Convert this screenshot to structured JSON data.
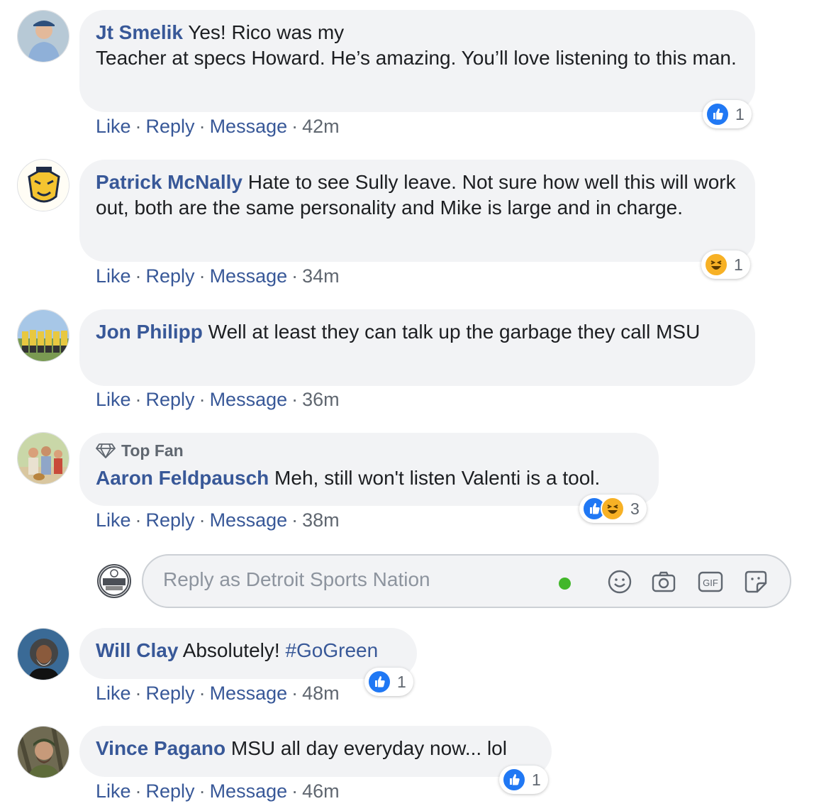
{
  "comments": [
    {
      "author": "Jt Smelik",
      "text": "Yes! Rico was my\nTeacher at specs Howard. He’s amazing. You’ll love listening to this man.",
      "actions": {
        "like": "Like",
        "reply": "Reply",
        "message": "Message",
        "time": "42m"
      },
      "reactions": {
        "icons": [
          "like-icon"
        ],
        "count": "1"
      }
    },
    {
      "author": "Patrick McNally",
      "text": "Hate to see Sully leave. Not sure how well this will work out, both are the same personality and Mike is large and in charge.",
      "actions": {
        "like": "Like",
        "reply": "Reply",
        "message": "Message",
        "time": "34m"
      },
      "reactions": {
        "icons": [
          "haha-icon"
        ],
        "count": "1"
      }
    },
    {
      "author": "Jon Philipp",
      "text": "Well at least they can talk up the garbage they call MSU",
      "actions": {
        "like": "Like",
        "reply": "Reply",
        "message": "Message",
        "time": "36m"
      }
    },
    {
      "badge": "Top Fan",
      "author": "Aaron Feldpausch",
      "text": "Meh, still won't listen Valenti is a tool.",
      "actions": {
        "like": "Like",
        "reply": "Reply",
        "message": "Message",
        "time": "38m"
      },
      "reactions": {
        "icons": [
          "like-icon",
          "haha-icon"
        ],
        "count": "3"
      }
    },
    {
      "author": "Will Clay",
      "text": "Absolutely!",
      "hashtag": "#GoGreen",
      "actions": {
        "like": "Like",
        "reply": "Reply",
        "message": "Message",
        "time": "48m"
      },
      "reactions": {
        "icons": [
          "like-icon"
        ],
        "count": "1"
      }
    },
    {
      "author": "Vince Pagano",
      "text": "MSU all day everyday now... lol",
      "actions": {
        "like": "Like",
        "reply": "Reply",
        "message": "Message",
        "time": "46m"
      },
      "reactions": {
        "icons": [
          "like-icon"
        ],
        "count": "1"
      }
    }
  ],
  "reply_box": {
    "placeholder": "Reply as Detroit Sports Nation",
    "icons": [
      "active-status-dot",
      "emoji-icon",
      "camera-icon",
      "gif-icon",
      "sticker-icon"
    ],
    "page_logo": "DETROIT SPORTS NATION"
  },
  "separator": "·",
  "colors": {
    "link": "#385898",
    "bubble": "#f2f3f5",
    "meta": "#606770",
    "like": "#2078f4",
    "haha": "#f7b125",
    "online": "#42b72a"
  }
}
